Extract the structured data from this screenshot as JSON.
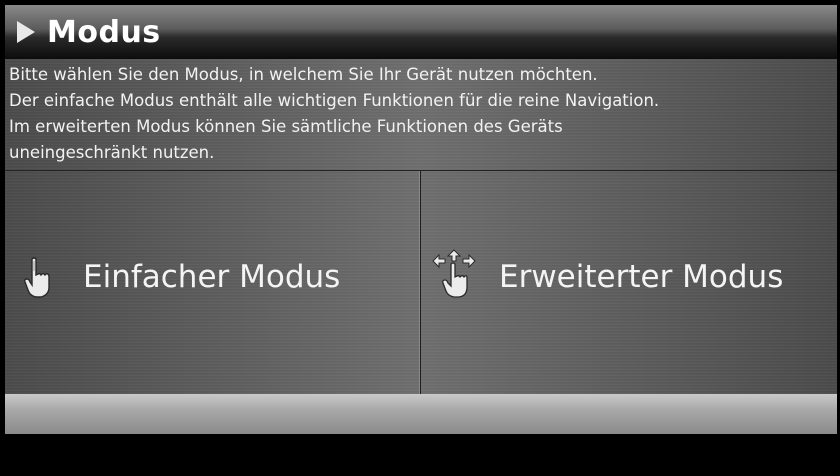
{
  "header": {
    "title": "Modus",
    "arrow_icon": "play-arrow-icon"
  },
  "description": {
    "lines": [
      "Bitte wählen Sie den Modus, in welchem Sie Ihr Gerät nutzen möchten.",
      "Der einfache Modus enthält alle wichtigen Funktionen für die reine Navigation.",
      "Im erweiterten Modus können Sie sämtliche Funktionen des Geräts",
      "uneingeschränkt nutzen."
    ]
  },
  "modes": [
    {
      "label": "Einfacher Modus",
      "icon": "single-finger-hand-icon"
    },
    {
      "label": "Erweiterter Modus",
      "icon": "multi-arrow-hand-icon"
    }
  ],
  "colors": {
    "text": "#f4f4f4",
    "panel": "#5e5e5e",
    "bottom_bar": "#a8a8a8",
    "frame": "#000000"
  }
}
